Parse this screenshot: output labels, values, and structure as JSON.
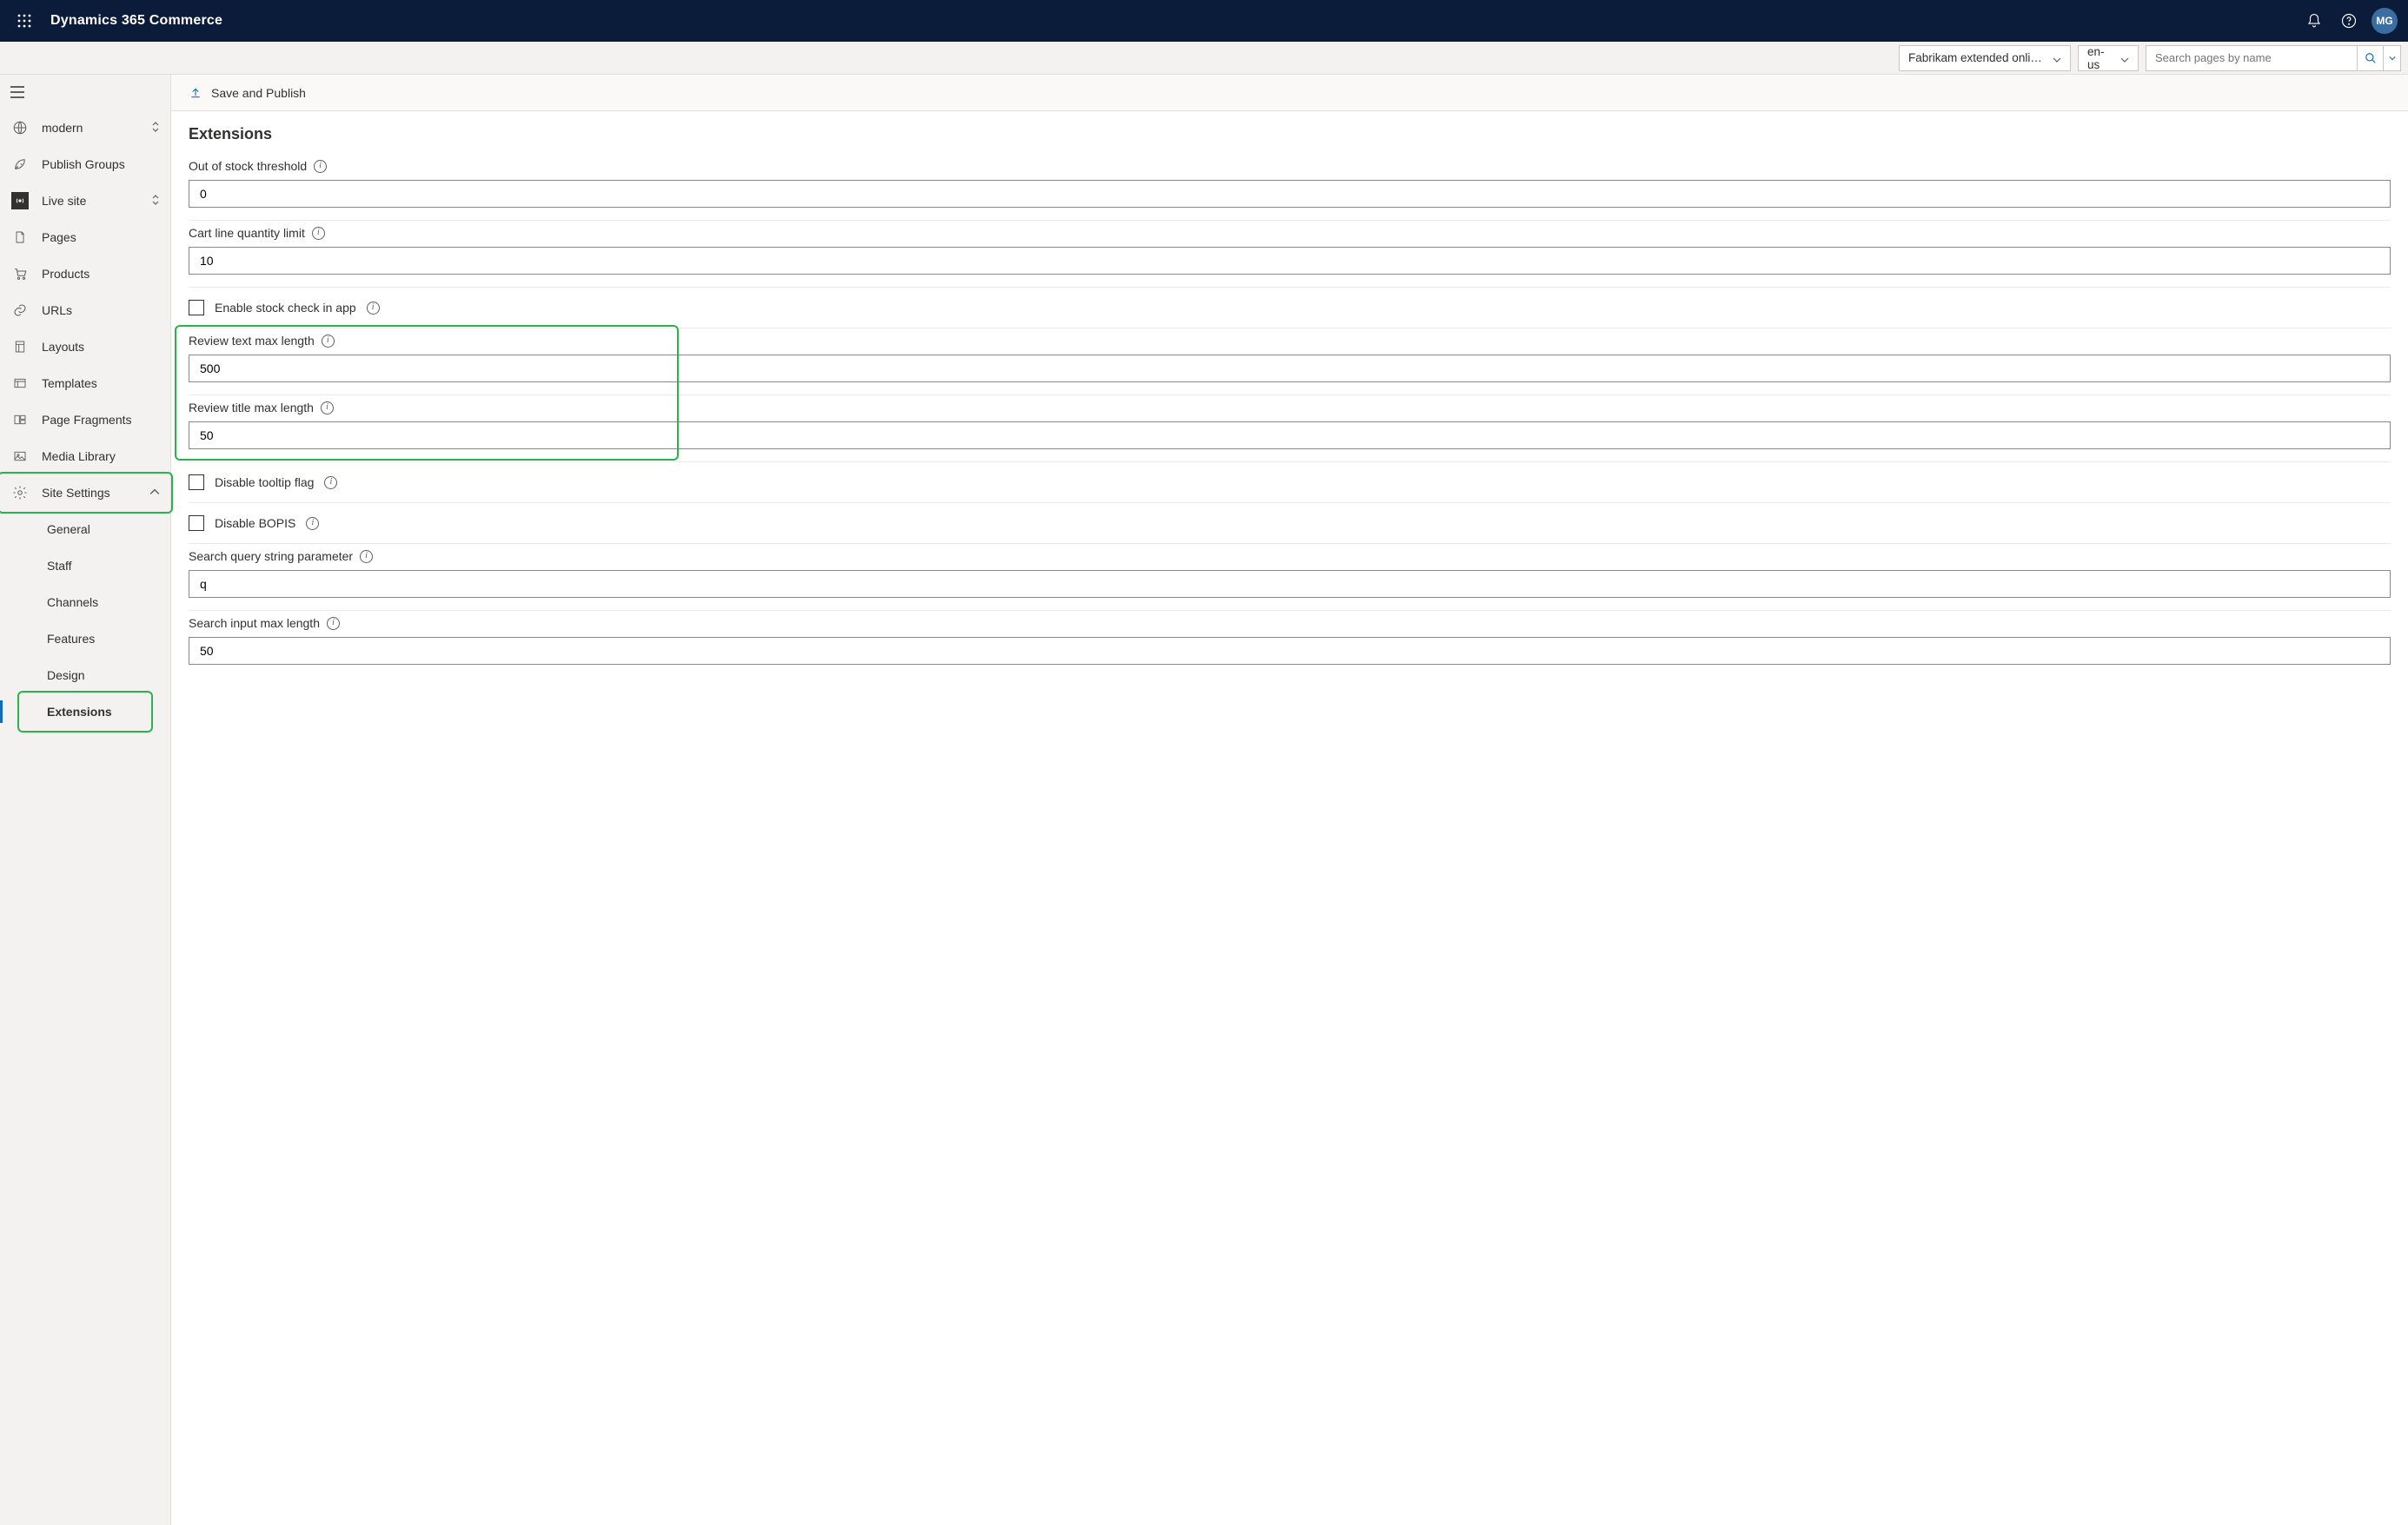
{
  "topbar": {
    "product_name": "Dynamics 365 Commerce",
    "avatar_initials": "MG"
  },
  "contextbar": {
    "store_selector": "Fabrikam extended online store",
    "locale_selector": "en-us",
    "search_placeholder": "Search pages by name"
  },
  "sidebar": {
    "site_name": "modern",
    "items": {
      "publish_groups": "Publish Groups",
      "live_site": "Live site",
      "pages": "Pages",
      "products": "Products",
      "urls": "URLs",
      "layouts": "Layouts",
      "templates": "Templates",
      "page_fragments": "Page Fragments",
      "media_library": "Media Library",
      "site_settings": "Site Settings"
    },
    "site_settings_children": {
      "general": "General",
      "staff": "Staff",
      "channels": "Channels",
      "features": "Features",
      "design": "Design",
      "extensions": "Extensions"
    }
  },
  "commandbar": {
    "save_publish": "Save and Publish"
  },
  "page": {
    "title": "Extensions",
    "fields": {
      "out_of_stock_threshold": {
        "label": "Out of stock threshold",
        "value": "0"
      },
      "cart_line_qty_limit": {
        "label": "Cart line quantity limit",
        "value": "10"
      },
      "enable_stock_check": {
        "label": "Enable stock check in app",
        "checked": false
      },
      "review_text_max": {
        "label": "Review text max length",
        "value": "500"
      },
      "review_title_max": {
        "label": "Review title max length",
        "value": "50"
      },
      "disable_tooltip": {
        "label": "Disable tooltip flag",
        "checked": false
      },
      "disable_bopis": {
        "label": "Disable BOPIS",
        "checked": false
      },
      "search_query_param": {
        "label": "Search query string parameter",
        "value": "q"
      },
      "search_input_max": {
        "label": "Search input max length",
        "value": "50"
      }
    }
  }
}
